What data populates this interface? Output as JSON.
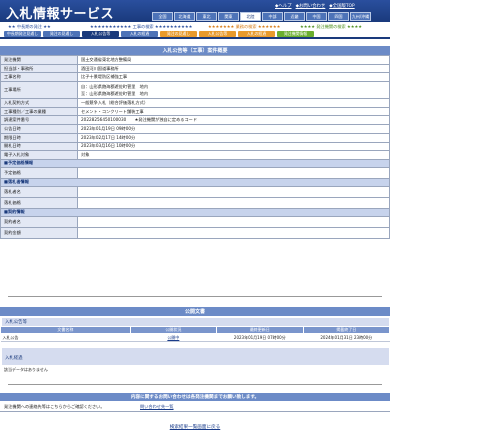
{
  "header": {
    "logo": "入札情報サービス",
    "util_links": [
      "◆ヘルプ",
      "◆お問い合わせ",
      "◆全国版TOP"
    ],
    "regions": [
      "全国",
      "北海道",
      "東北",
      "関東",
      "北陸",
      "中部",
      "近畿",
      "中国",
      "四国",
      "九州/沖縄"
    ],
    "active_region": "北陸"
  },
  "categories": {
    "a": "★★ 中長期の発注 ★★",
    "b": "★★★★★★★★★★★ 工事の検索 ★★★★★★★★★★",
    "c": "★★★★★★★ 業務の検索 ★★★★★★",
    "d": "★★★★ 発注機関の検索 ★★★★"
  },
  "nav_tabs": [
    {
      "label": "中長期発注見通し",
      "style": "blue"
    },
    {
      "label": "発注の見通し",
      "style": "blue"
    },
    {
      "label": "入札公告等",
      "style": "blue-active"
    },
    {
      "label": "入札の経過",
      "style": "blue"
    },
    {
      "label": "発注の見通し",
      "style": "orange"
    },
    {
      "label": "入札公告等",
      "style": "orange"
    },
    {
      "label": "入札の経過",
      "style": "orange"
    },
    {
      "label": "発注機関情報",
      "style": "green"
    }
  ],
  "detail": {
    "title": "入札公告等（工事）案件概要",
    "rows": [
      {
        "label": "発注機関",
        "value": "国土交通省東北地方整備局"
      },
      {
        "label": "担当部・事務所",
        "value": "酒田河川国道事務所"
      },
      {
        "label": "工事名称",
        "value": "比子十景堤防区補強工事"
      },
      {
        "label": "工事場所",
        "value": "自：山形県飽海郡遊佐町菅里　地内\n至：山形県飽海郡遊佐町菅里　地内"
      },
      {
        "label": "入札契約方式",
        "value": "一般競争入札（総合評価落札方式）"
      },
      {
        "label": "工事種別／工事の業種",
        "value": "セメント・コンクリート舗装工事"
      },
      {
        "label": "調達案件番号",
        "value": "20228256450100030　　★発注機関が独自に定めるコード"
      },
      {
        "label": "公告日時",
        "value": "2023年01月19日 09時00分"
      },
      {
        "label": "期限日時",
        "value": "2023年02月17日 14時00分"
      },
      {
        "label": "開札日時",
        "value": "2023年03月16日 10時00分"
      },
      {
        "label": "電子入札対象",
        "value": "対象"
      }
    ],
    "sub_sections": [
      {
        "title": "■予定価格情報",
        "rows": [
          {
            "label": "予定価格",
            "value": ""
          }
        ]
      },
      {
        "title": "■落札者情報",
        "rows": [
          {
            "label": "落札者名",
            "value": ""
          },
          {
            "label": "落札価格",
            "value": ""
          }
        ]
      },
      {
        "title": "■契約情報",
        "rows": [
          {
            "label": "契約者名",
            "value": ""
          },
          {
            "label": "契約金額",
            "value": ""
          }
        ]
      }
    ]
  },
  "documents": {
    "title": "公開文書",
    "label": "入札公告等",
    "columns": [
      "文書名称",
      "公開状況",
      "最終更新日",
      "掲載終了日"
    ],
    "rows": [
      {
        "name": "入札公告",
        "status": "公開中",
        "updated": "2023年01月19日 07時00分",
        "end": "2024年01月31日 23時00分"
      }
    ],
    "result_label": "入札経過",
    "result_empty": "該当データはありません"
  },
  "contact": {
    "title": "内容に関するお問い合わせは各発注機関までお願い致します。",
    "text": "発注機関への連絡先等はこちらからご確認ください。",
    "link": "問い合わせ先一覧"
  },
  "back_link": "検索結果一覧画面に戻る"
}
